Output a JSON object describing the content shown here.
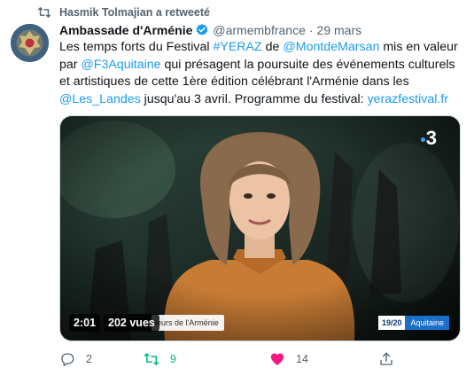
{
  "retweet_context": {
    "text": "Hasmik Tolmajian a retweeté",
    "icon": "retweet-icon"
  },
  "tweet": {
    "author_name": "Ambassade d'Arménie",
    "verified": true,
    "handle": "@armembfrance",
    "dot": "·",
    "date": "29 mars",
    "text": {
      "t1": "Les temps forts du Festival ",
      "hashtag": "#YERAZ",
      "t2": " de ",
      "mention1": "@MontdeMarsan",
      "t3": " mis en valeur par ",
      "mention2": "@F3Aquitaine",
      "t4": " qui présagent la poursuite des événements culturels et artistiques de cette 1ère édition célébrant l'Arménie dans les ",
      "mention3": "@Les_Landes",
      "t5": " jusqu'au 3 avril. Programme du festival: ",
      "link": "yerazfestival.fr"
    },
    "media": {
      "duration": "2:01",
      "views": "202 vues",
      "caption": "leurs de l'Arménie",
      "tag_time": "19/20",
      "tag_region": "Aquitaine",
      "channel_logo": "3"
    },
    "actions": {
      "reply_count": "2",
      "retweet_count": "9",
      "like_count": "14"
    }
  },
  "colors": {
    "link": "#1d9bf0",
    "retweet_active": "#00ba7c",
    "like_active": "#f91880",
    "secondary_text": "#536471"
  }
}
